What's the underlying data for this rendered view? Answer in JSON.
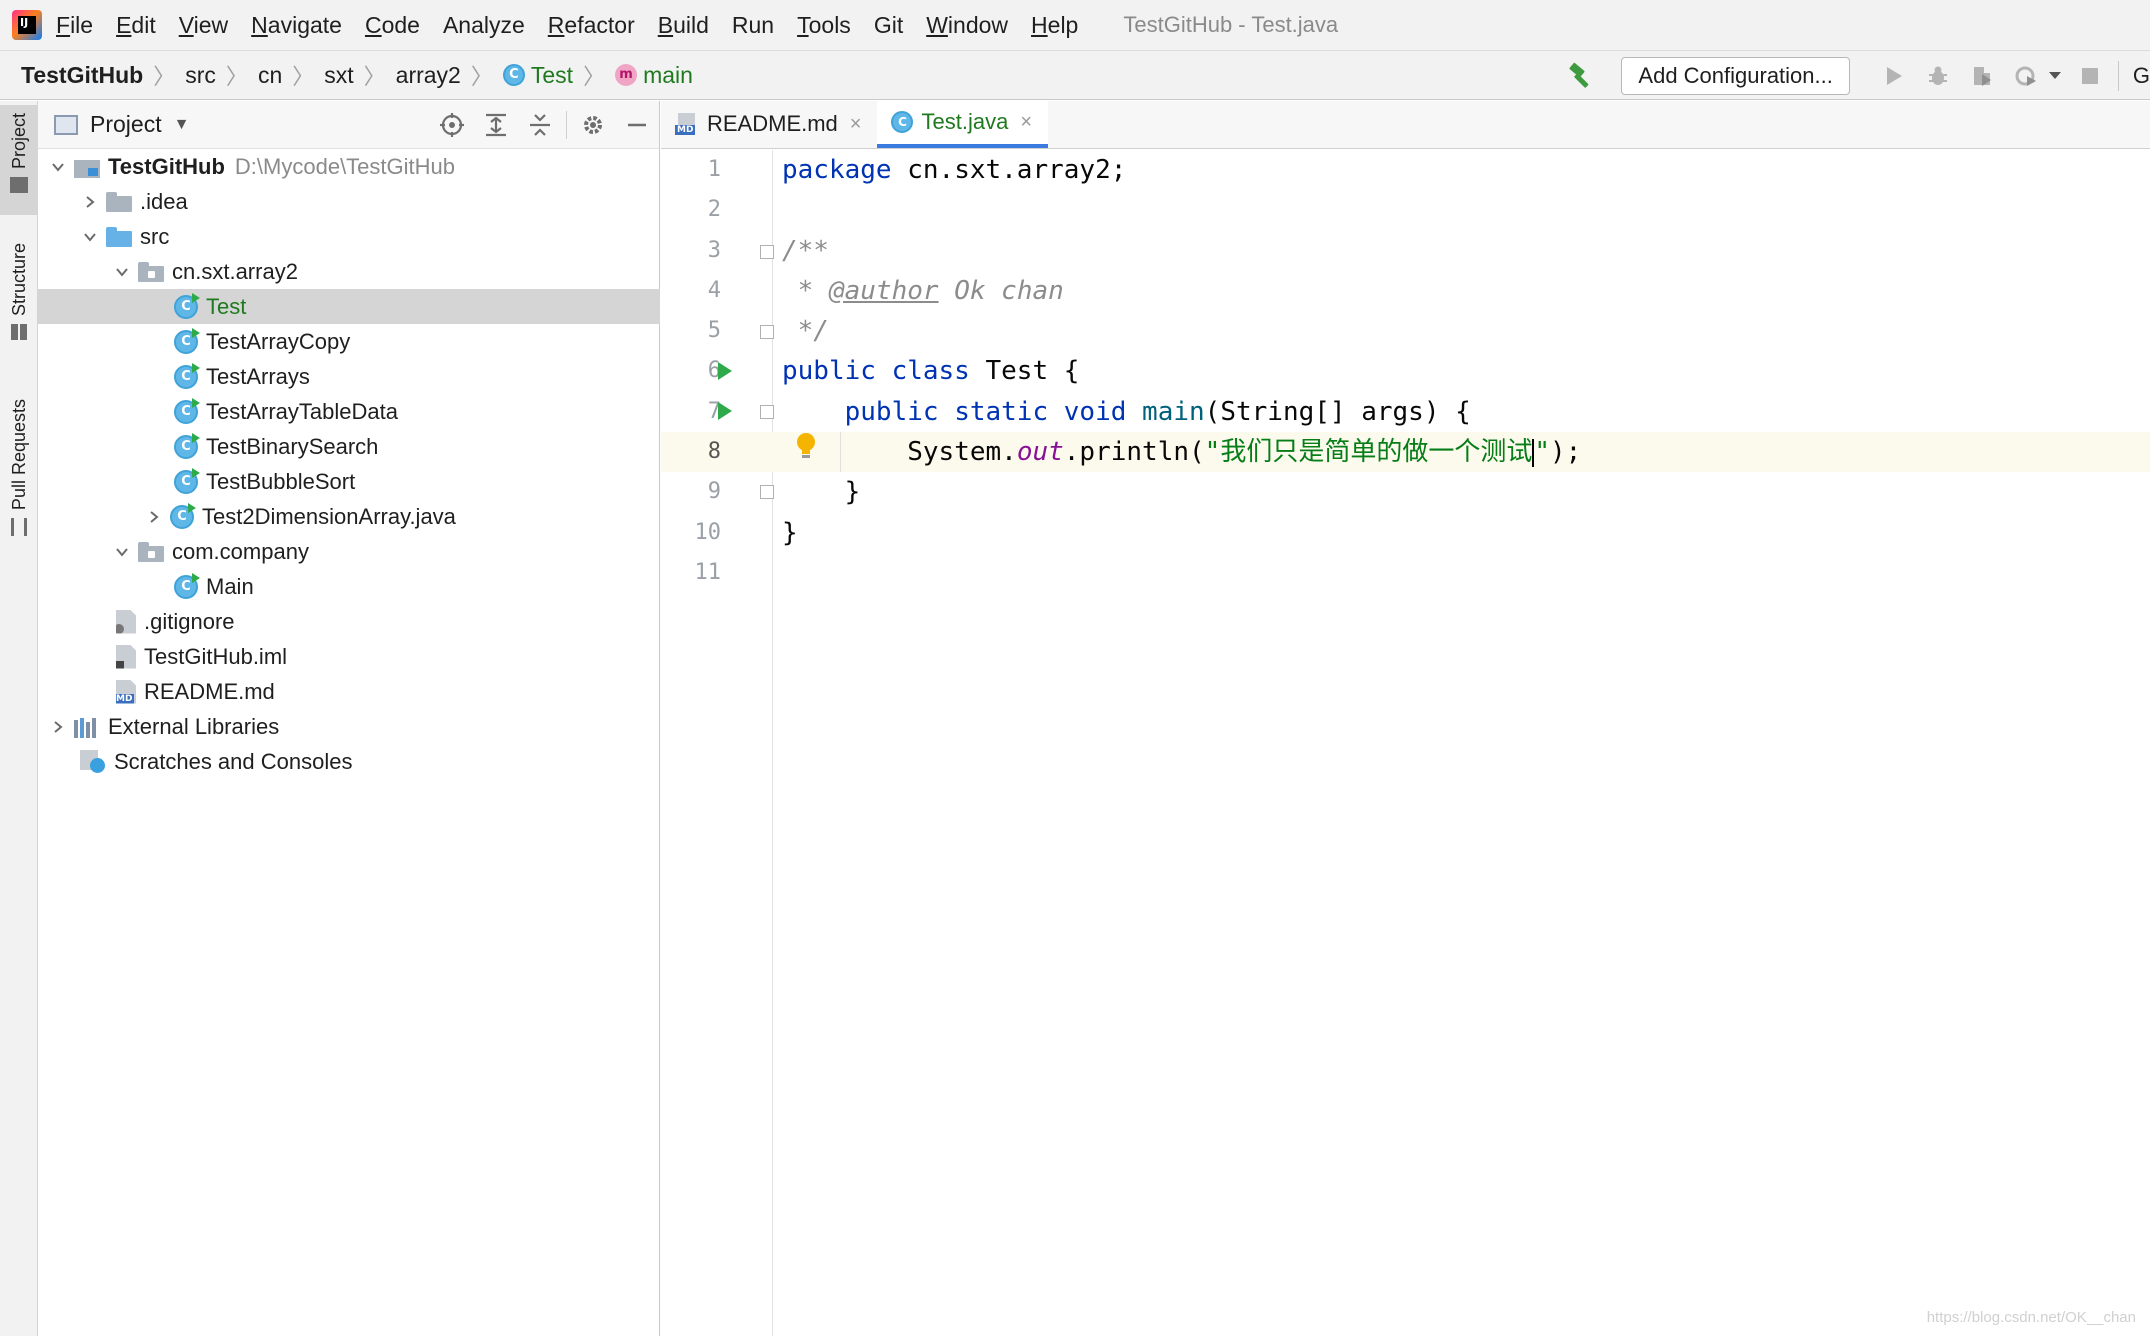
{
  "menu": {
    "items": [
      {
        "label": "File",
        "mnemonic": "F",
        "rest": "ile"
      },
      {
        "label": "Edit",
        "mnemonic": "E",
        "rest": "dit"
      },
      {
        "label": "View",
        "mnemonic": "V",
        "rest": "iew"
      },
      {
        "label": "Navigate",
        "mnemonic": "N",
        "rest": "avigate"
      },
      {
        "label": "Code",
        "mnemonic": "C",
        "rest": "ode"
      },
      {
        "label": "Analyze",
        "mnemonic": "",
        "rest": "Analyze"
      },
      {
        "label": "Refactor",
        "mnemonic": "R",
        "rest": "efactor"
      },
      {
        "label": "Build",
        "mnemonic": "B",
        "rest": "uild"
      },
      {
        "label": "Run",
        "mnemonic": "",
        "rest": "Run"
      },
      {
        "label": "Tools",
        "mnemonic": "T",
        "rest": "ools"
      },
      {
        "label": "Git",
        "mnemonic": "",
        "rest": "Git"
      },
      {
        "label": "Window",
        "mnemonic": "W",
        "rest": "indow"
      },
      {
        "label": "Help",
        "mnemonic": "H",
        "rest": "elp"
      }
    ],
    "window_title": "TestGitHub - Test.java"
  },
  "breadcrumb": {
    "items": [
      "TestGitHub",
      "src",
      "cn",
      "sxt",
      "array2"
    ],
    "class_crumb": "Test",
    "method_crumb": "main",
    "class_icon_letter": "C",
    "method_icon_letter": "m"
  },
  "toolbar": {
    "add_configuration_label": "Add Configuration...",
    "overflow_text": "G"
  },
  "tool_strip": {
    "project_label": "Project",
    "structure_label": "Structure",
    "pull_requests_label": "Pull Requests"
  },
  "project_panel": {
    "title": "Project",
    "root": {
      "name": "TestGitHub",
      "path": "D:\\Mycode\\TestGitHub"
    },
    "rows": {
      "idea": ".idea",
      "src": "src",
      "pkg_array2": "cn.sxt.array2",
      "test": "Test",
      "test_array_copy": "TestArrayCopy",
      "test_arrays": "TestArrays",
      "test_array_table_data": "TestArrayTableData",
      "test_binary_search": "TestBinarySearch",
      "test_bubble_sort": "TestBubbleSort",
      "test_2d_array": "Test2DimensionArray.java",
      "pkg_company": "com.company",
      "main": "Main",
      "gitignore": ".gitignore",
      "iml": "TestGitHub.iml",
      "readme": "README.md",
      "external_libraries": "External Libraries",
      "scratches": "Scratches and Consoles"
    },
    "class_icon_letter": "C",
    "md_badge": "MD"
  },
  "editor": {
    "tabs": [
      {
        "label": "README.md",
        "close": "×"
      },
      {
        "label": "Test.java",
        "close": "×"
      }
    ],
    "line_numbers": [
      "1",
      "2",
      "3",
      "4",
      "5",
      "6",
      "7",
      "8",
      "9",
      "10",
      "11"
    ],
    "code": {
      "l1_kw": "package",
      "l1_rest": " cn.sxt.array2;",
      "l3": "/**",
      "l4_star": " * ",
      "l4_tag": "@author",
      "l4_rest": " Ok chan",
      "l5": " */",
      "l6_kw": "public class",
      "l6_rest": " Test {",
      "l7_indent": "    ",
      "l7_kw": "public static void",
      "l7_sp": " ",
      "l7_fn": "main",
      "l7_rest": "(String[] args) {",
      "l8_indent": "        ",
      "l8_sys": "System.",
      "l8_field": "out",
      "l8_call": ".println(",
      "l8_str": "\"我们只是简单的做一个测试",
      "l8_str_end": "\"",
      "l8_end": ");",
      "l9": "    }",
      "l10": "}"
    }
  },
  "watermark": "https://blog.csdn.net/OK__chan",
  "colors": {
    "keyword": "#0033b3",
    "string": "#067d17",
    "comment": "#8c8c8c",
    "field": "#871094",
    "function": "#00627a",
    "accent_tab": "#3b7be0",
    "run_green": "#2eaa4a"
  }
}
